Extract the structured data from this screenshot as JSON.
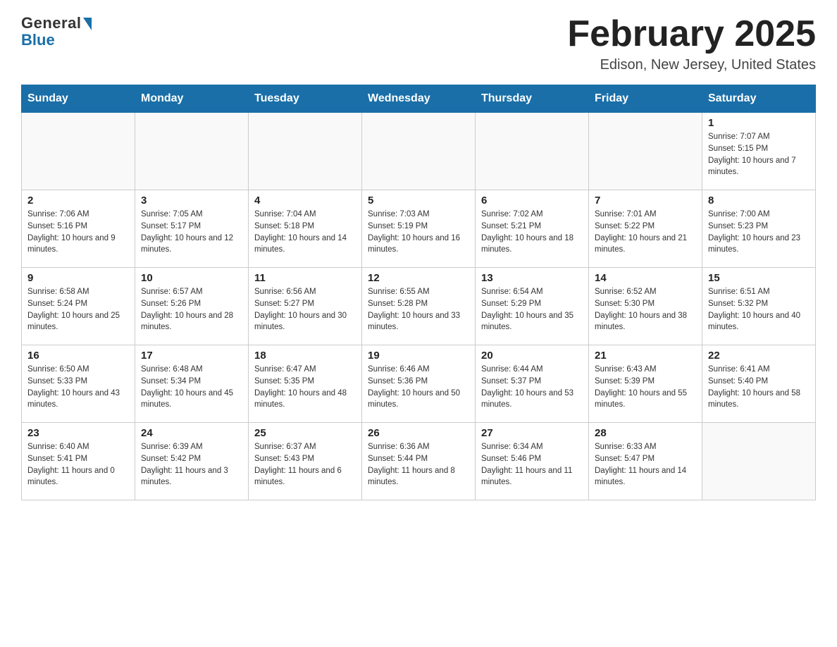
{
  "header": {
    "logo_general": "General",
    "logo_blue": "Blue",
    "month_title": "February 2025",
    "location": "Edison, New Jersey, United States"
  },
  "days_of_week": [
    "Sunday",
    "Monday",
    "Tuesday",
    "Wednesday",
    "Thursday",
    "Friday",
    "Saturday"
  ],
  "weeks": [
    [
      {
        "day": "",
        "info": ""
      },
      {
        "day": "",
        "info": ""
      },
      {
        "day": "",
        "info": ""
      },
      {
        "day": "",
        "info": ""
      },
      {
        "day": "",
        "info": ""
      },
      {
        "day": "",
        "info": ""
      },
      {
        "day": "1",
        "info": "Sunrise: 7:07 AM\nSunset: 5:15 PM\nDaylight: 10 hours and 7 minutes."
      }
    ],
    [
      {
        "day": "2",
        "info": "Sunrise: 7:06 AM\nSunset: 5:16 PM\nDaylight: 10 hours and 9 minutes."
      },
      {
        "day": "3",
        "info": "Sunrise: 7:05 AM\nSunset: 5:17 PM\nDaylight: 10 hours and 12 minutes."
      },
      {
        "day": "4",
        "info": "Sunrise: 7:04 AM\nSunset: 5:18 PM\nDaylight: 10 hours and 14 minutes."
      },
      {
        "day": "5",
        "info": "Sunrise: 7:03 AM\nSunset: 5:19 PM\nDaylight: 10 hours and 16 minutes."
      },
      {
        "day": "6",
        "info": "Sunrise: 7:02 AM\nSunset: 5:21 PM\nDaylight: 10 hours and 18 minutes."
      },
      {
        "day": "7",
        "info": "Sunrise: 7:01 AM\nSunset: 5:22 PM\nDaylight: 10 hours and 21 minutes."
      },
      {
        "day": "8",
        "info": "Sunrise: 7:00 AM\nSunset: 5:23 PM\nDaylight: 10 hours and 23 minutes."
      }
    ],
    [
      {
        "day": "9",
        "info": "Sunrise: 6:58 AM\nSunset: 5:24 PM\nDaylight: 10 hours and 25 minutes."
      },
      {
        "day": "10",
        "info": "Sunrise: 6:57 AM\nSunset: 5:26 PM\nDaylight: 10 hours and 28 minutes."
      },
      {
        "day": "11",
        "info": "Sunrise: 6:56 AM\nSunset: 5:27 PM\nDaylight: 10 hours and 30 minutes."
      },
      {
        "day": "12",
        "info": "Sunrise: 6:55 AM\nSunset: 5:28 PM\nDaylight: 10 hours and 33 minutes."
      },
      {
        "day": "13",
        "info": "Sunrise: 6:54 AM\nSunset: 5:29 PM\nDaylight: 10 hours and 35 minutes."
      },
      {
        "day": "14",
        "info": "Sunrise: 6:52 AM\nSunset: 5:30 PM\nDaylight: 10 hours and 38 minutes."
      },
      {
        "day": "15",
        "info": "Sunrise: 6:51 AM\nSunset: 5:32 PM\nDaylight: 10 hours and 40 minutes."
      }
    ],
    [
      {
        "day": "16",
        "info": "Sunrise: 6:50 AM\nSunset: 5:33 PM\nDaylight: 10 hours and 43 minutes."
      },
      {
        "day": "17",
        "info": "Sunrise: 6:48 AM\nSunset: 5:34 PM\nDaylight: 10 hours and 45 minutes."
      },
      {
        "day": "18",
        "info": "Sunrise: 6:47 AM\nSunset: 5:35 PM\nDaylight: 10 hours and 48 minutes."
      },
      {
        "day": "19",
        "info": "Sunrise: 6:46 AM\nSunset: 5:36 PM\nDaylight: 10 hours and 50 minutes."
      },
      {
        "day": "20",
        "info": "Sunrise: 6:44 AM\nSunset: 5:37 PM\nDaylight: 10 hours and 53 minutes."
      },
      {
        "day": "21",
        "info": "Sunrise: 6:43 AM\nSunset: 5:39 PM\nDaylight: 10 hours and 55 minutes."
      },
      {
        "day": "22",
        "info": "Sunrise: 6:41 AM\nSunset: 5:40 PM\nDaylight: 10 hours and 58 minutes."
      }
    ],
    [
      {
        "day": "23",
        "info": "Sunrise: 6:40 AM\nSunset: 5:41 PM\nDaylight: 11 hours and 0 minutes."
      },
      {
        "day": "24",
        "info": "Sunrise: 6:39 AM\nSunset: 5:42 PM\nDaylight: 11 hours and 3 minutes."
      },
      {
        "day": "25",
        "info": "Sunrise: 6:37 AM\nSunset: 5:43 PM\nDaylight: 11 hours and 6 minutes."
      },
      {
        "day": "26",
        "info": "Sunrise: 6:36 AM\nSunset: 5:44 PM\nDaylight: 11 hours and 8 minutes."
      },
      {
        "day": "27",
        "info": "Sunrise: 6:34 AM\nSunset: 5:46 PM\nDaylight: 11 hours and 11 minutes."
      },
      {
        "day": "28",
        "info": "Sunrise: 6:33 AM\nSunset: 5:47 PM\nDaylight: 11 hours and 14 minutes."
      },
      {
        "day": "",
        "info": ""
      }
    ]
  ]
}
